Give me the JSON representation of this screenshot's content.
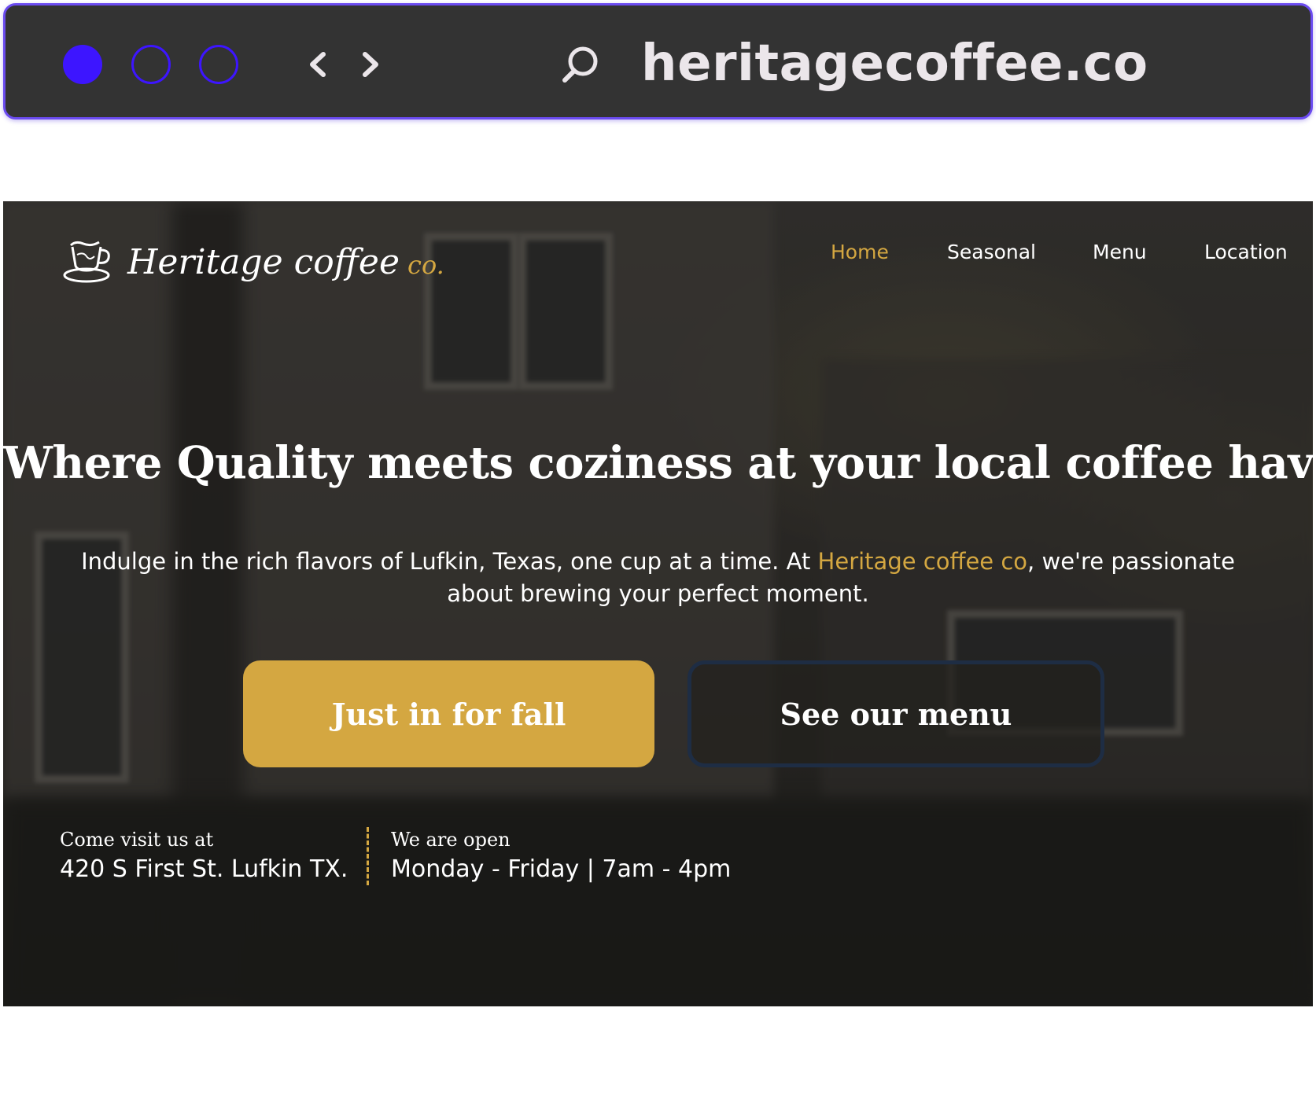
{
  "browser": {
    "url": "heritagecoffee.co",
    "window_controls": [
      "close-dot",
      "minimize-dot",
      "maximize-dot"
    ],
    "nav_icons": [
      "chevron-left-icon",
      "chevron-right-icon"
    ],
    "search_icon": "search-icon",
    "accent_color": "#3d15ff"
  },
  "site": {
    "logo": {
      "name": "Heritage coffee",
      "suffix": "co.",
      "icon": "coffee-cup-icon"
    },
    "nav": [
      {
        "label": "Home",
        "active": true
      },
      {
        "label": "Seasonal",
        "active": false
      },
      {
        "label": "Menu",
        "active": false
      },
      {
        "label": "Location",
        "active": false
      }
    ],
    "hero": {
      "headline": "Where Quality meets coziness at your local coffee haven",
      "sub_before": "Indulge in the rich flavors of Lufkin, Texas, one cup at a time. At ",
      "sub_accent": "Heritage coffee co",
      "sub_after": ", we're passionate about brewing your perfect moment.",
      "primary_button": "Just in for fall",
      "secondary_button": "See our menu"
    },
    "info": {
      "visit_label": "Come visit us at",
      "address": "420 S First St. Lufkin TX.",
      "open_label": "We are open",
      "hours": "Monday - Friday | 7am - 4pm"
    },
    "colors": {
      "gold": "#d4a741",
      "white": "#ffffff",
      "button_border": "#1e2d44"
    }
  }
}
